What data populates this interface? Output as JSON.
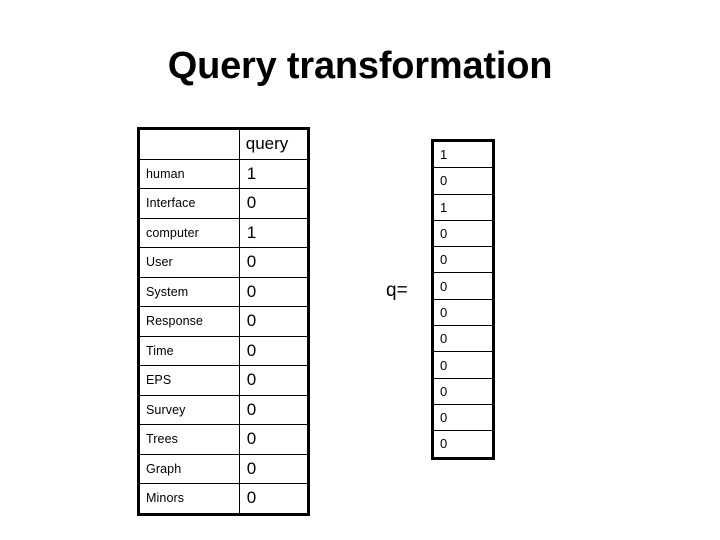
{
  "slide": {
    "title": "Query transformation",
    "background_color": "#ffffff",
    "text_color": "#000000"
  },
  "term_matrix": {
    "name": "term-query-matrix",
    "columns": [
      "",
      "query"
    ],
    "header_blank": "",
    "header_query": "query",
    "rows": [
      {
        "term": "human",
        "value": "1"
      },
      {
        "term": "Interface",
        "value": "0"
      },
      {
        "term": "computer",
        "value": "1"
      },
      {
        "term": "User",
        "value": "0"
      },
      {
        "term": "System",
        "value": "0"
      },
      {
        "term": "Response",
        "value": "0"
      },
      {
        "term": "Time",
        "value": "0"
      },
      {
        "term": "EPS",
        "value": "0"
      },
      {
        "term": "Survey",
        "value": "0"
      },
      {
        "term": "Trees",
        "value": "0"
      },
      {
        "term": "Graph",
        "value": "0"
      },
      {
        "term": "Minors",
        "value": "0"
      }
    ]
  },
  "query_vector": {
    "label": "q=",
    "values": [
      "1",
      "0",
      "1",
      "0",
      "0",
      "0",
      "0",
      "0",
      "0",
      "0",
      "0",
      "0"
    ]
  }
}
